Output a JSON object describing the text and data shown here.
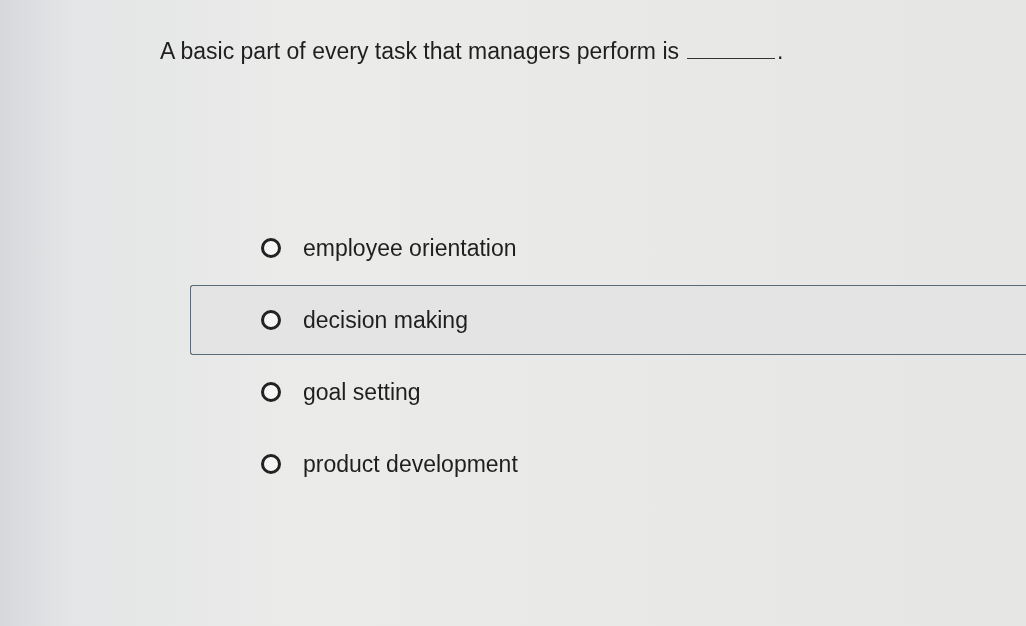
{
  "question": {
    "text": "A basic part of every task that managers perform is",
    "blank_after": true,
    "end": "."
  },
  "options": [
    {
      "label": "employee orientation",
      "selected": false,
      "highlighted": false
    },
    {
      "label": "decision making",
      "selected": false,
      "highlighted": true
    },
    {
      "label": "goal setting",
      "selected": false,
      "highlighted": false
    },
    {
      "label": "product development",
      "selected": false,
      "highlighted": false
    }
  ]
}
